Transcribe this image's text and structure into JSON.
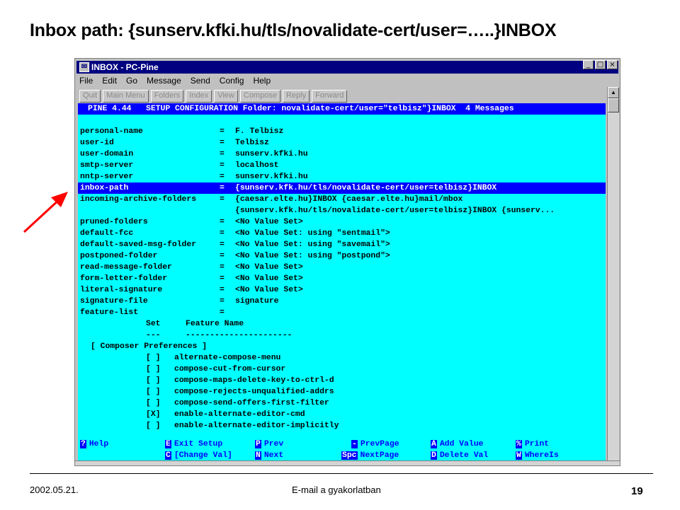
{
  "slide": {
    "title": "Inbox path: {sunserv.kfki.hu/tls/novalidate-cert/user=…..}INBOX",
    "footer_date": "2002.05.21.",
    "footer_center": "E-mail a gyakorlatban",
    "page_number": "19",
    "arrow_color": "#ff0000"
  },
  "window": {
    "title": "INBOX - PC-Pine",
    "icon": "pine-app-icon",
    "controls": [
      "_",
      "□",
      "×"
    ],
    "menu": [
      "File",
      "Edit",
      "Go",
      "Message",
      "Send",
      "Config",
      "Help"
    ],
    "toolbar": [
      "Quit",
      "Main Menu",
      "Folders",
      "Index",
      "View",
      "Compose",
      "Reply",
      "Forward"
    ]
  },
  "terminal": {
    "bg_color": "#00ffff",
    "highlight_color": "#0000ff",
    "header": "PINE 4.44   SETUP CONFIGURATION Folder: novalidate-cert/user=\"telbisz\"}INBOX  4 Messages",
    "settings": [
      {
        "key": "personal-name",
        "value": "F. Telbisz"
      },
      {
        "key": "user-id",
        "value": "Telbisz"
      },
      {
        "key": "user-domain",
        "value": "sunserv.kfki.hu"
      },
      {
        "key": "smtp-server",
        "value": "localhost"
      },
      {
        "key": "nntp-server",
        "value": "sunserv.kfki.hu"
      },
      {
        "key": "inbox-path",
        "value": "{sunserv.kfk.hu/tls/novalidate-cert/user=telbisz}INBOX",
        "selected": true
      },
      {
        "key": "incoming-archive-folders",
        "value": "{caesar.elte.hu}INBOX {caesar.elte.hu}mail/mbox"
      },
      {
        "key": "",
        "value": "{sunserv.kfk.hu/tls/novalidate-cert/user=telbisz}INBOX {sunserv...",
        "continuation": true
      },
      {
        "key": "pruned-folders",
        "value": "<No Value Set>"
      },
      {
        "key": "default-fcc",
        "value": "<No Value Set: using \"sentmail\">"
      },
      {
        "key": "default-saved-msg-folder",
        "value": "<No Value Set: using \"savemail\">"
      },
      {
        "key": "postponed-folder",
        "value": "<No Value Set: using \"postpond\">"
      },
      {
        "key": "read-message-folder",
        "value": "<No Value Set>"
      },
      {
        "key": "form-letter-folder",
        "value": "<No Value Set>"
      },
      {
        "key": "literal-signature",
        "value": "<No Value Set>"
      },
      {
        "key": "signature-file",
        "value": "signature"
      },
      {
        "key": "feature-list",
        "value": ""
      }
    ],
    "feature_header": {
      "set": "Set",
      "name": "Feature Name"
    },
    "feature_underline": {
      "set": "---",
      "name": "----------------------"
    },
    "feature_group": "[ Composer Preferences ]",
    "features": [
      {
        "box": "[ ]",
        "name": "alternate-compose-menu"
      },
      {
        "box": "[ ]",
        "name": "compose-cut-from-cursor"
      },
      {
        "box": "[ ]",
        "name": "compose-maps-delete-key-to-ctrl-d"
      },
      {
        "box": "[ ]",
        "name": "compose-rejects-unqualified-addrs"
      },
      {
        "box": "[ ]",
        "name": "compose-send-offers-first-filter"
      },
      {
        "box": "[X]",
        "name": "enable-alternate-editor-cmd"
      },
      {
        "box": "[ ]",
        "name": "enable-alternate-editor-implicitly"
      }
    ],
    "footer_keys": [
      {
        "key": "?",
        "label": "Help"
      },
      {
        "key": "E",
        "label": "Exit Setup"
      },
      {
        "key": "P",
        "label": "Prev"
      },
      {
        "key": "-",
        "label": "PrevPage"
      },
      {
        "key": "A",
        "label": "Add Value"
      },
      {
        "key": "%",
        "label": "Print"
      },
      {
        "key": "C",
        "label": "[Change Val]"
      },
      {
        "key": "N",
        "label": "Next"
      },
      {
        "key": "Spc",
        "label": "NextPage"
      },
      {
        "key": "D",
        "label": "Delete Val"
      },
      {
        "key": "W",
        "label": "WhereIs"
      }
    ]
  }
}
